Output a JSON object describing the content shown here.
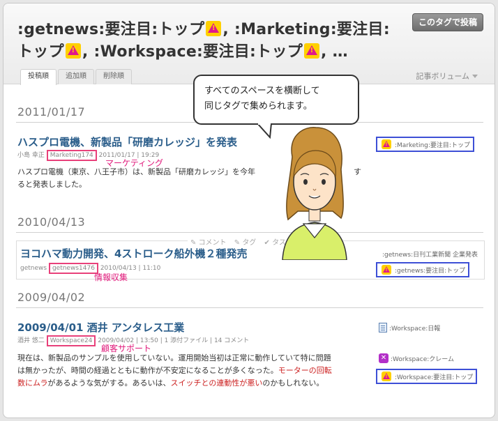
{
  "header": {
    "title_parts": [
      ":getnews:要注目:トップ",
      ", :Marketing:要注目:",
      "トップ",
      ", :Workspace:要注目:トップ",
      ", …"
    ],
    "post_tag_button": "このタグで投稿",
    "tabs": [
      "投稿順",
      "追加順",
      "削除順"
    ],
    "volume_label": "記事ボリューム"
  },
  "callout": {
    "line1": "すべてのスペースを横断して",
    "line2": "同じタグで集められます。"
  },
  "groups": [
    {
      "date": "2011/01/17",
      "entry": {
        "title": "ハスプロ電機、新製品「研磨カレッジ」を発表",
        "author": "小島 幸正",
        "space": "Marketing174",
        "timestamp": "2011/01/17 | 19:29",
        "annotation": "マーケティング",
        "body_line1": "ハスプロ電機（東京、八王子市）は、新製品「研磨カレッジ」を今年",
        "body_line1b": "す",
        "body_line2": "ると発表しました。",
        "tags": [
          ":Marketing:要注目:トップ"
        ]
      }
    },
    {
      "date": "2010/04/13",
      "entry": {
        "title": "ヨコハマ動力開発、4ストローク船外機２種発売",
        "author": "getnews",
        "space": "getnews1476",
        "timestamp": "2010/04/13 | 11:10",
        "annotation": "情報収集",
        "actions": [
          "コメント",
          "タグ",
          "タスク"
        ],
        "tags": [
          ":getnews:日刊工業新聞 企業発表",
          ":getnews:要注目:トップ"
        ]
      }
    },
    {
      "date": "2009/04/02",
      "entry": {
        "title": "2009/04/01 酒井 アンタレス工業",
        "author": "酒井 悠二",
        "space": "Workspace24",
        "timestamp": "2009/04/02 | 13:50 | 1 添付ファイル | 14 コメント",
        "annotation": "顧客サポート",
        "body": {
          "l1": "現在は、新製品のサンプルを使用していない。運用開始当初は正常に動作していて特に問題",
          "l2a": "は無かったが、時間の経過とともに動作が不安定になることが多くなった。",
          "l2red": "モーターの回転",
          "l3red": "数にムラ",
          "l3b": "があるような気がする。あるいは、",
          "l3red2": "スイッチとの連動性が悪い",
          "l3c": "のかもしれない。"
        },
        "tags": [
          ":Workspace:日報",
          ":Workspace:クレーム",
          ":Workspace:要注目:トップ"
        ]
      }
    }
  ],
  "colors": {
    "title_link": "#2a5d8a",
    "highlight_pink": "#e8407a",
    "highlight_blue": "#3d4fd6",
    "alert_red": "#cc2222"
  },
  "icons": {
    "warning": "warning-icon",
    "report": "document-icon",
    "claim": "close-icon"
  }
}
